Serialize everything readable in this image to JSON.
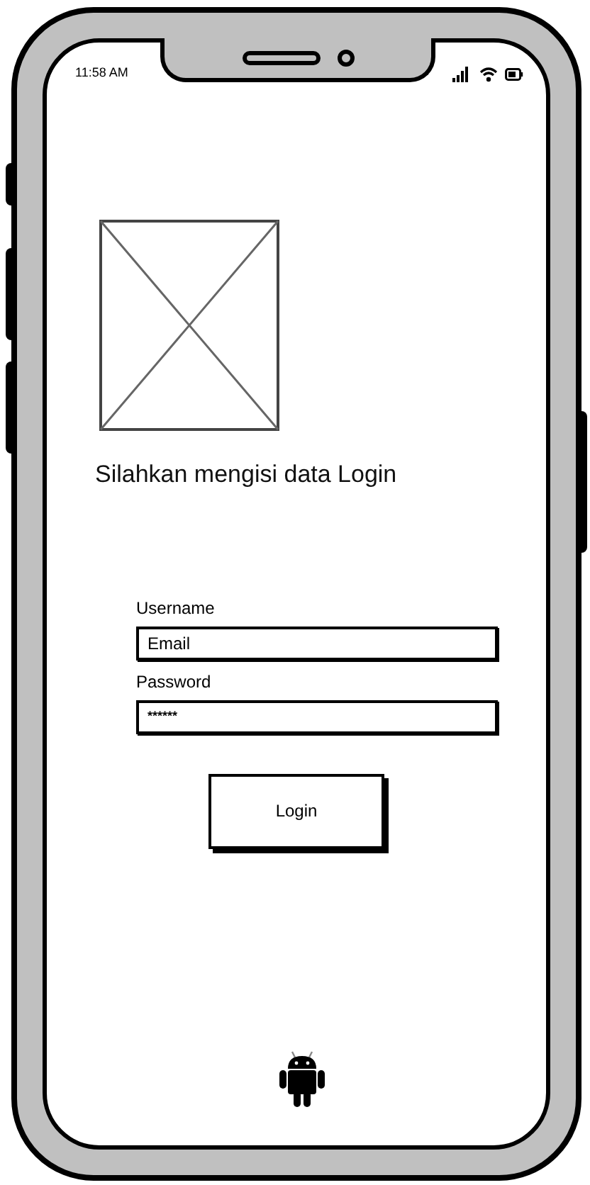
{
  "status_bar": {
    "time": "11:58 AM"
  },
  "heading": "Silahkan mengisi data Login",
  "form": {
    "fields": [
      {
        "label": "Username",
        "value": "Email",
        "kind": "text"
      },
      {
        "label": "Password",
        "value": "******",
        "kind": "password"
      }
    ],
    "button": "Login"
  }
}
